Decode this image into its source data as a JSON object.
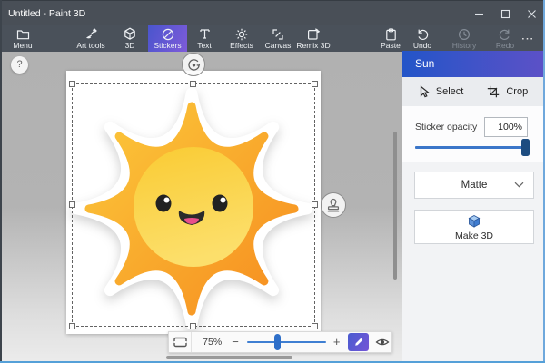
{
  "window": {
    "title": "Untitled - Paint 3D",
    "controls": {
      "minimize": "minimize",
      "maximize": "maximize",
      "close": "close"
    }
  },
  "toolbar": {
    "items": [
      {
        "label": "Menu",
        "state": "normal"
      },
      {
        "label": "Art tools",
        "state": "normal"
      },
      {
        "label": "3D",
        "state": "normal"
      },
      {
        "label": "Stickers",
        "state": "selected"
      },
      {
        "label": "Text",
        "state": "normal"
      },
      {
        "label": "Effects",
        "state": "normal"
      },
      {
        "label": "Canvas",
        "state": "normal"
      },
      {
        "label": "Remix 3D",
        "state": "normal"
      },
      {
        "label": "Paste",
        "state": "normal"
      },
      {
        "label": "Undo",
        "state": "normal"
      },
      {
        "label": "History",
        "state": "disabled"
      },
      {
        "label": "Redo",
        "state": "disabled"
      }
    ],
    "more_label": "⋯"
  },
  "canvas": {
    "help_label": "?"
  },
  "panel": {
    "title": "Sun",
    "select_label": "Select",
    "crop_label": "Crop",
    "opacity_label": "Sticker opacity",
    "opacity_value": "100%",
    "finish_selected": "Matte",
    "make3d_label": "Make 3D"
  },
  "zoombar": {
    "zoom_value": "75%",
    "minus_label": "−",
    "plus_label": "+"
  },
  "colors": {
    "titlebar": "#494f57",
    "toolbar": "#4a515a",
    "selected_tab_gradient": [
      "#4a55cd",
      "#7e5bd9"
    ],
    "panel_header_gradient": [
      "#2355c8",
      "#5c51c7"
    ],
    "opacity_slider_track": "#3b76c9",
    "opacity_slider_thumb": "#1d4c80",
    "zoom_slider": "#2e6fc9",
    "sun_ray_gradient": [
      "#fcc93b",
      "#f68c1f"
    ],
    "sun_core_gradient": [
      "#f9cb33",
      "#fcdf6b"
    ],
    "sun_tongue": "#e94f8b",
    "window_border": "#55a0d8"
  }
}
